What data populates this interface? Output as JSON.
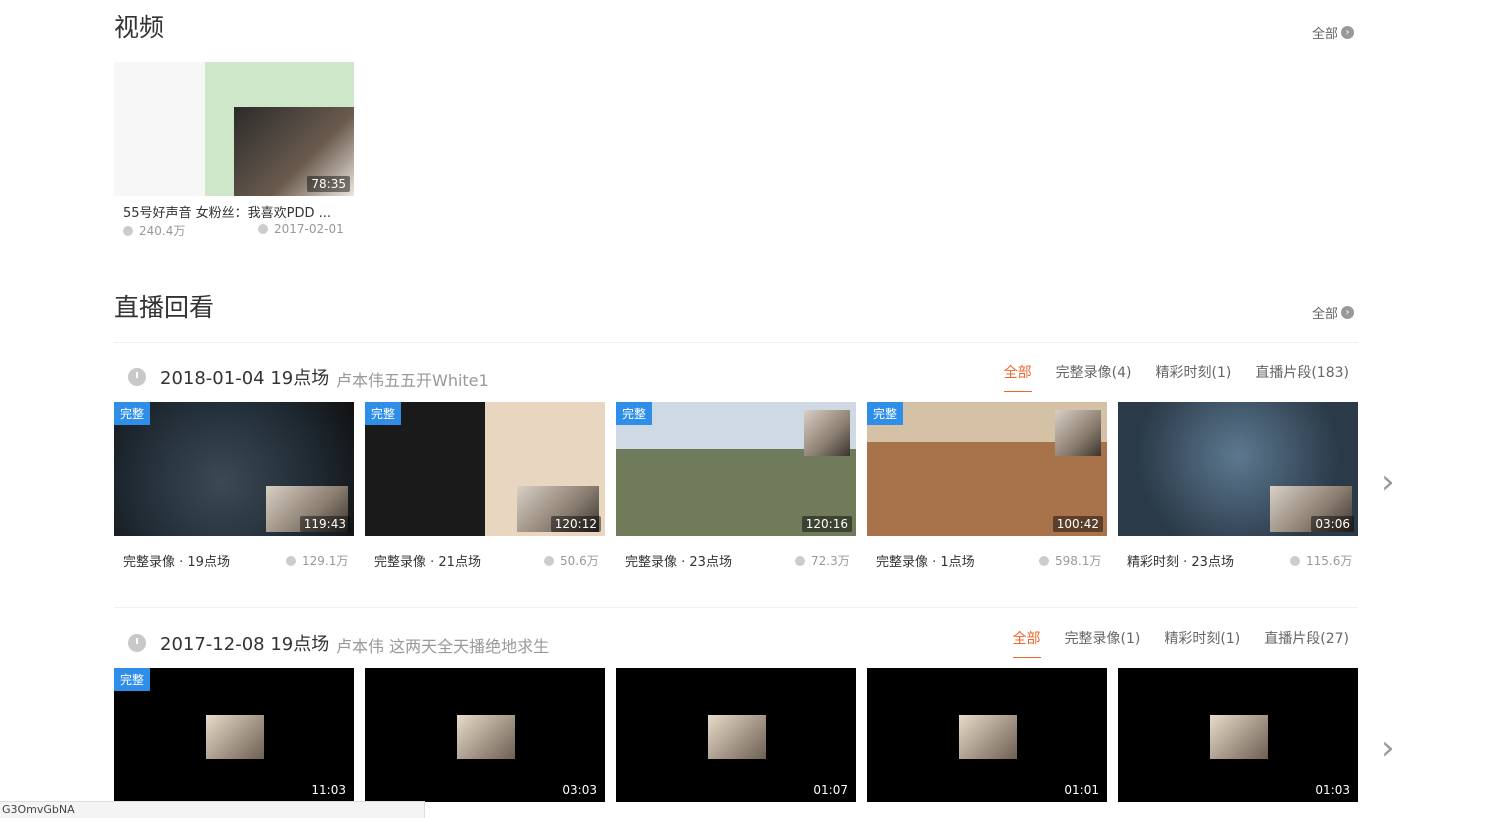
{
  "video_section": {
    "title": "视频",
    "all_label": "全部",
    "video": {
      "duration": "78:35",
      "title": "55号好声音 女粉丝：我喜欢PDD ...",
      "views": "240.4万",
      "date": "2017-02-01"
    }
  },
  "replay_section": {
    "title": "直播回看",
    "all_label": "全部",
    "groups": [
      {
        "date": "2018-01-04 19点场",
        "subtitle": "卢本伟五五开White1",
        "tabs": [
          "全部",
          "完整录像(4)",
          "精彩时刻(1)",
          "直播片段(183)"
        ],
        "items": [
          {
            "badge": "完整",
            "duration": "119:43",
            "caption": "完整录像 · 19点场",
            "views": "129.1万"
          },
          {
            "badge": "完整",
            "duration": "120:12",
            "caption": "完整录像 · 21点场",
            "views": "50.6万"
          },
          {
            "badge": "完整",
            "duration": "120:16",
            "caption": "完整录像 · 23点场",
            "views": "72.3万"
          },
          {
            "badge": "完整",
            "duration": "100:42",
            "caption": "完整录像 · 1点场",
            "views": "598.1万"
          },
          {
            "badge": "",
            "duration": "03:06",
            "caption": "精彩时刻 · 23点场",
            "views": "115.6万"
          }
        ]
      },
      {
        "date": "2017-12-08 19点场",
        "subtitle": "卢本伟 这两天全天播绝地求生",
        "tabs": [
          "全部",
          "完整录像(1)",
          "精彩时刻(1)",
          "直播片段(27)"
        ],
        "items": [
          {
            "badge": "完整",
            "duration": "11:03"
          },
          {
            "badge": "",
            "duration": "03:03"
          },
          {
            "badge": "",
            "duration": "01:07"
          },
          {
            "badge": "",
            "duration": "01:01"
          },
          {
            "badge": "",
            "duration": "01:03"
          }
        ]
      }
    ]
  },
  "status_bar": "G3OmvGbNA"
}
